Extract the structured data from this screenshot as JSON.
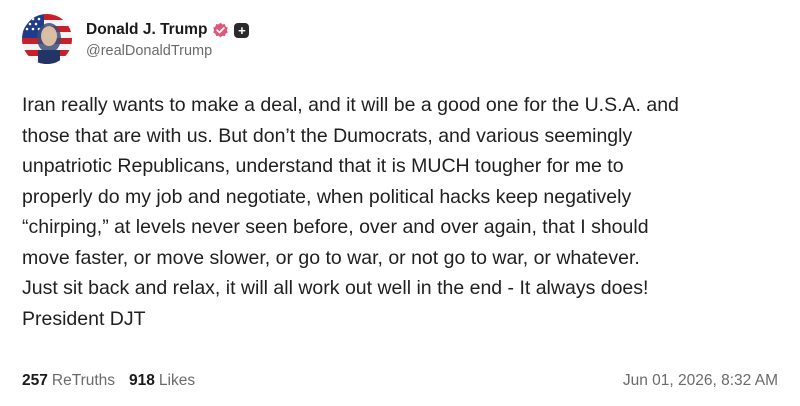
{
  "author": {
    "display_name": "Donald J. Trump",
    "handle": "@realDonaldTrump",
    "avatar_icon": "flag-portrait-avatar",
    "verified_icon": "verified-badge-icon",
    "plus_icon": "follow-plus-icon",
    "verified_color": "#e0567a"
  },
  "post": {
    "lines": [
      "Iran really wants to make a deal, and it will be a good one for the U.S.A. and",
      "those that are with us. But don’t the Dumocrats, and various seemingly",
      "unpatriotic Republicans,  understand that it is MUCH tougher for me to",
      "properly do my job and negotiate, when political hacks keep negatively",
      "“chirping,” at levels never seen before, over and over again, that I should",
      "move faster, or move slower, or go to war, or not go to war, or whatever.",
      "Just sit back and relax, it will all work out well in the end - It always does!",
      "President DJT"
    ]
  },
  "stats": {
    "retruths_count": "257",
    "retruths_label": "ReTruths",
    "likes_count": "918",
    "likes_label": "Likes"
  },
  "timestamp": "Jun 01, 2026, 8:32 AM"
}
